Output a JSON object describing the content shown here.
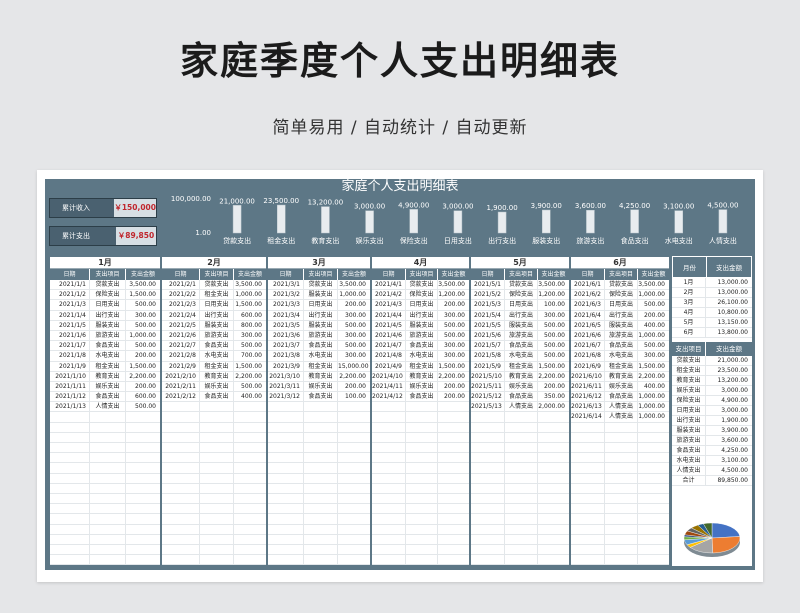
{
  "page": {
    "title": "家庭季度个人支出明细表",
    "subtitle": "简单易用 / 自动统计 / 自动更新"
  },
  "report": {
    "title": "家庭个人支出明细表",
    "summary": [
      {
        "label": "累计收入",
        "value": "￥150,000"
      },
      {
        "label": "累计支出",
        "value": "￥89,850"
      }
    ]
  },
  "chart_data": {
    "type": "bar",
    "categories": [
      "贷款支出",
      "租金支出",
      "教育支出",
      "娱乐支出",
      "保险支出",
      "日用支出",
      "出行支出",
      "服装支出",
      "旅游支出",
      "食品支出",
      "水电支出",
      "人情支出"
    ],
    "values": [
      21000,
      23500,
      13200,
      3000,
      4900,
      3000,
      1900,
      3900,
      3600,
      4250,
      3100,
      4500
    ],
    "value_labels": [
      "21,000.00",
      "23,500.00",
      "13,200.00",
      "3,000.00",
      "4,900.00",
      "3,000.00",
      "1,900.00",
      "3,900.00",
      "3,600.00",
      "4,250.00",
      "3,100.00",
      "4,500.00"
    ],
    "ytick_labels": [
      "100,000.00",
      "1.00"
    ],
    "scale": "log",
    "ylim": [
      1,
      100000
    ],
    "colors": {
      "bar": "#e8ecef",
      "bar_edge": "#ffffff"
    }
  },
  "columns": {
    "date": "日期",
    "item": "支出项目",
    "amount": "支出金额"
  },
  "months": [
    {
      "label": "1月",
      "rows": [
        [
          "2021/1/1",
          "贷款支出",
          "3,500.00"
        ],
        [
          "2021/1/2",
          "保险支出",
          "1,500.00"
        ],
        [
          "2021/1/3",
          "日用支出",
          "500.00"
        ],
        [
          "2021/1/4",
          "出行支出",
          "300.00"
        ],
        [
          "2021/1/5",
          "服装支出",
          "500.00"
        ],
        [
          "2021/1/6",
          "旅游支出",
          "1,000.00"
        ],
        [
          "2021/1/7",
          "食品支出",
          "500.00"
        ],
        [
          "2021/1/8",
          "水电支出",
          "200.00"
        ],
        [
          "2021/1/9",
          "租金支出",
          "1,500.00"
        ],
        [
          "2021/1/10",
          "教育支出",
          "2,200.00"
        ],
        [
          "2021/1/11",
          "娱乐支出",
          "200.00"
        ],
        [
          "2021/1/12",
          "食品支出",
          "600.00"
        ],
        [
          "2021/1/13",
          "人情支出",
          "500.00"
        ]
      ]
    },
    {
      "label": "2月",
      "rows": [
        [
          "2021/2/1",
          "贷款支出",
          "3,500.00"
        ],
        [
          "2021/2/2",
          "租金支出",
          "1,000.00"
        ],
        [
          "2021/2/3",
          "日用支出",
          "1,500.00"
        ],
        [
          "2021/2/4",
          "出行支出",
          "600.00"
        ],
        [
          "2021/2/5",
          "服装支出",
          "800.00"
        ],
        [
          "2021/2/6",
          "旅游支出",
          "300.00"
        ],
        [
          "2021/2/7",
          "食品支出",
          "500.00"
        ],
        [
          "2021/2/8",
          "水电支出",
          "700.00"
        ],
        [
          "2021/2/9",
          "租金支出",
          "1,500.00"
        ],
        [
          "2021/2/10",
          "教育支出",
          "2,200.00"
        ],
        [
          "2021/2/11",
          "娱乐支出",
          "500.00"
        ],
        [
          "2021/2/12",
          "食品支出",
          "400.00"
        ]
      ]
    },
    {
      "label": "3月",
      "rows": [
        [
          "2021/3/1",
          "贷款支出",
          "3,500.00"
        ],
        [
          "2021/3/2",
          "服装支出",
          "1,000.00"
        ],
        [
          "2021/3/3",
          "日用支出",
          "200.00"
        ],
        [
          "2021/3/4",
          "出行支出",
          "300.00"
        ],
        [
          "2021/3/5",
          "服装支出",
          "500.00"
        ],
        [
          "2021/3/6",
          "旅游支出",
          "300.00"
        ],
        [
          "2021/3/7",
          "食品支出",
          "500.00"
        ],
        [
          "2021/3/8",
          "水电支出",
          "300.00"
        ],
        [
          "2021/3/9",
          "租金支出",
          "15,000.00"
        ],
        [
          "2021/3/10",
          "教育支出",
          "2,200.00"
        ],
        [
          "2021/3/11",
          "娱乐支出",
          "200.00"
        ],
        [
          "2021/3/12",
          "食品支出",
          "100.00"
        ]
      ]
    },
    {
      "label": "4月",
      "rows": [
        [
          "2021/4/1",
          "贷款支出",
          "3,500.00"
        ],
        [
          "2021/4/2",
          "保险支出",
          "1,200.00"
        ],
        [
          "2021/4/3",
          "日用支出",
          "200.00"
        ],
        [
          "2021/4/4",
          "出行支出",
          "300.00"
        ],
        [
          "2021/4/5",
          "服装支出",
          "500.00"
        ],
        [
          "2021/4/6",
          "旅游支出",
          "500.00"
        ],
        [
          "2021/4/7",
          "食品支出",
          "300.00"
        ],
        [
          "2021/4/8",
          "水电支出",
          "300.00"
        ],
        [
          "2021/4/9",
          "租金支出",
          "1,500.00"
        ],
        [
          "2021/4/10",
          "教育支出",
          "2,200.00"
        ],
        [
          "2021/4/11",
          "娱乐支出",
          "200.00"
        ],
        [
          "2021/4/12",
          "食品支出",
          "200.00"
        ]
      ]
    },
    {
      "label": "5月",
      "rows": [
        [
          "2021/5/1",
          "贷款支出",
          "3,500.00"
        ],
        [
          "2021/5/2",
          "保险支出",
          "1,200.00"
        ],
        [
          "2021/5/3",
          "日用支出",
          "100.00"
        ],
        [
          "2021/5/4",
          "出行支出",
          "300.00"
        ],
        [
          "2021/5/5",
          "服装支出",
          "500.00"
        ],
        [
          "2021/5/6",
          "旅游支出",
          "500.00"
        ],
        [
          "2021/5/7",
          "食品支出",
          "500.00"
        ],
        [
          "2021/5/8",
          "水电支出",
          "500.00"
        ],
        [
          "2021/5/9",
          "租金支出",
          "1,500.00"
        ],
        [
          "2021/5/10",
          "教育支出",
          "2,200.00"
        ],
        [
          "2021/5/11",
          "娱乐支出",
          "200.00"
        ],
        [
          "2021/5/12",
          "食品支出",
          "350.00"
        ],
        [
          "2021/5/13",
          "人情支出",
          "2,000.00"
        ]
      ]
    },
    {
      "label": "6月",
      "rows": [
        [
          "2021/6/1",
          "贷款支出",
          "3,500.00"
        ],
        [
          "2021/6/2",
          "保险支出",
          "1,000.00"
        ],
        [
          "2021/6/3",
          "日用支出",
          "500.00"
        ],
        [
          "2021/6/4",
          "出行支出",
          "200.00"
        ],
        [
          "2021/6/5",
          "服装支出",
          "400.00"
        ],
        [
          "2021/6/6",
          "旅游支出",
          "1,000.00"
        ],
        [
          "2021/6/7",
          "食品支出",
          "500.00"
        ],
        [
          "2021/6/8",
          "水电支出",
          "300.00"
        ],
        [
          "2021/6/9",
          "租金支出",
          "1,500.00"
        ],
        [
          "2021/6/10",
          "教育支出",
          "2,200.00"
        ],
        [
          "2021/6/11",
          "娱乐支出",
          "400.00"
        ],
        [
          "2021/6/12",
          "食品支出",
          "1,000.00"
        ],
        [
          "2021/6/13",
          "人情支出",
          "1,000.00"
        ],
        [
          "2021/6/14",
          "人情支出",
          "1,000.00"
        ]
      ]
    }
  ],
  "monthly_summary": {
    "headers": [
      "月份",
      "支出金额"
    ],
    "rows": [
      [
        "1月",
        "13,000.00"
      ],
      [
        "2月",
        "13,000.00"
      ],
      [
        "3月",
        "26,100.00"
      ],
      [
        "4月",
        "10,800.00"
      ],
      [
        "5月",
        "13,150.00"
      ],
      [
        "6月",
        "13,800.00"
      ]
    ]
  },
  "category_summary": {
    "headers": [
      "支出项目",
      "支出金额"
    ],
    "rows": [
      [
        "贷款支出",
        "21,000.00"
      ],
      [
        "租金支出",
        "23,500.00"
      ],
      [
        "教育支出",
        "13,200.00"
      ],
      [
        "娱乐支出",
        "3,000.00"
      ],
      [
        "保险支出",
        "4,900.00"
      ],
      [
        "日用支出",
        "3,000.00"
      ],
      [
        "出行支出",
        "1,900.00"
      ],
      [
        "服装支出",
        "3,900.00"
      ],
      [
        "旅游支出",
        "3,600.00"
      ],
      [
        "食品支出",
        "4,250.00"
      ],
      [
        "水电支出",
        "3,100.00"
      ],
      [
        "人情支出",
        "4,500.00"
      ],
      [
        "合计",
        "89,850.00"
      ]
    ]
  },
  "pie_colors": [
    "#4472c4",
    "#ed7d31",
    "#a5a5a5",
    "#ffc000",
    "#5b9bd5",
    "#70ad47",
    "#264478",
    "#9e480e",
    "#636363",
    "#997300",
    "#255e91",
    "#43682b"
  ]
}
